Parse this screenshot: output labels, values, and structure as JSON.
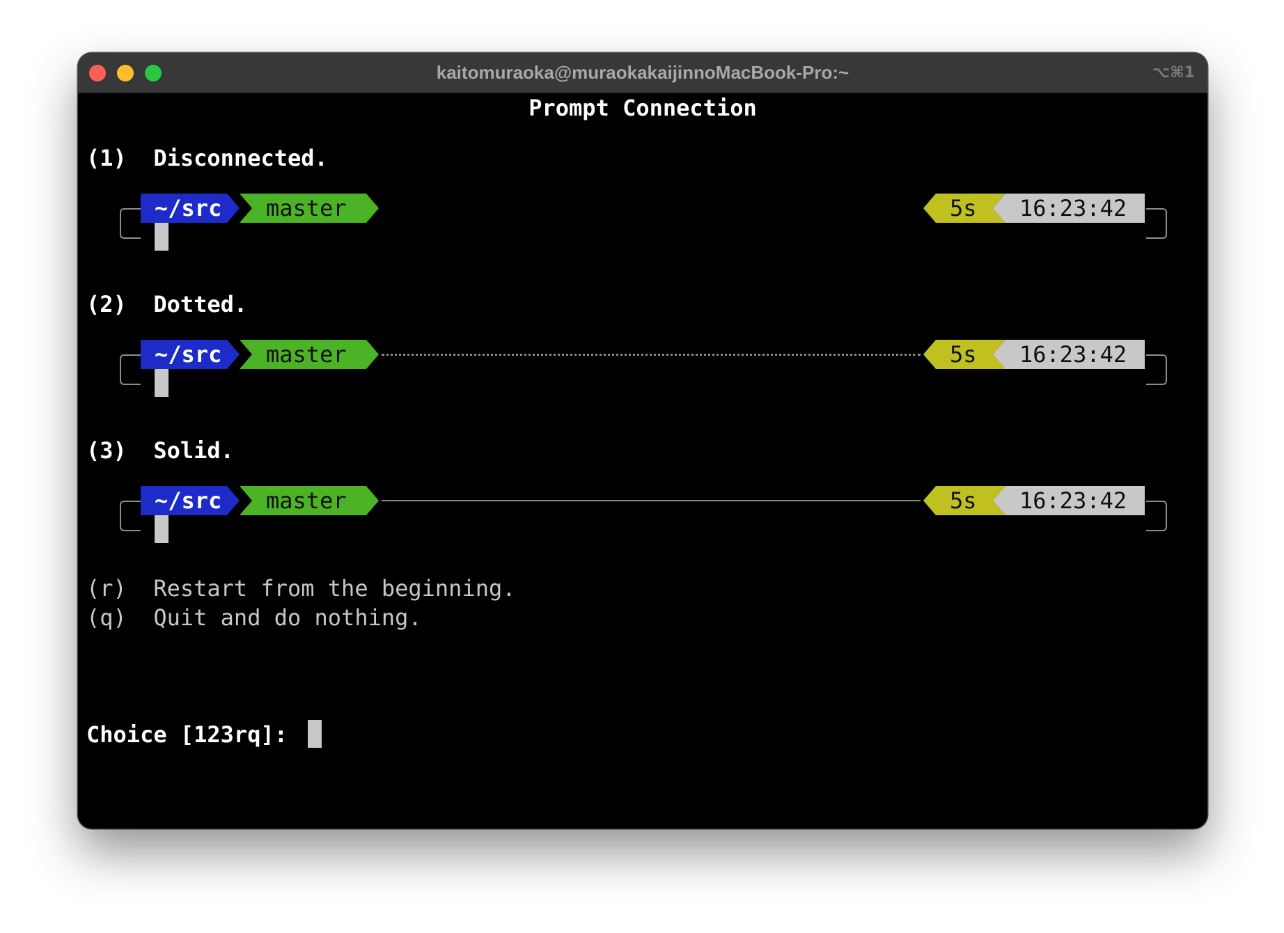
{
  "window": {
    "title": "kaitomuraoka@muraokakaijinnoMacBook-Pro:~",
    "shortcut": "⌥⌘1"
  },
  "terminal": {
    "heading": "Prompt Connection",
    "options": [
      {
        "key": "(1)",
        "label": "Disconnected.",
        "connection": "none"
      },
      {
        "key": "(2)",
        "label": "Dotted.",
        "connection": "dotted"
      },
      {
        "key": "(3)",
        "label": "Solid.",
        "connection": "solid"
      }
    ],
    "segments": {
      "dir": "~/src",
      "git": "master",
      "duration": "5s",
      "time": "16:23:42"
    },
    "colors": {
      "dir": "#1d2cc9",
      "git": "#4db326",
      "duration": "#c0c021",
      "time": "#c8c8c8",
      "background": "#000000",
      "titlebar": "#383838"
    },
    "restart": {
      "key": "(r)",
      "label": "Restart from the beginning."
    },
    "quit": {
      "key": "(q)",
      "label": "Quit and do nothing."
    },
    "choice_prompt": "Choice [123rq]:"
  }
}
